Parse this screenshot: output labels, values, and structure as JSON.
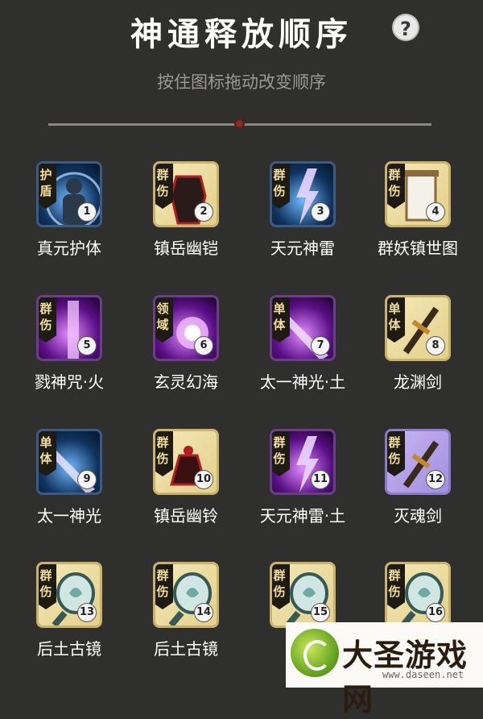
{
  "header": {
    "title": "神通释放顺序",
    "help": "?",
    "subtitle": "按住图标拖动改变顺序"
  },
  "skills": [
    {
      "order": "1",
      "name": "真元护体",
      "tag": "护盾",
      "theme": "blue",
      "icon": "shield-figure-icon"
    },
    {
      "order": "2",
      "name": "镇岳幽铠",
      "tag": "群伤",
      "theme": "gold",
      "icon": "armor-icon"
    },
    {
      "order": "3",
      "name": "天元神雷",
      "tag": "群伤",
      "theme": "blue",
      "icon": "lightning-icon"
    },
    {
      "order": "4",
      "name": "群妖镇世图",
      "tag": "群伤",
      "theme": "gold",
      "icon": "scroll-icon"
    },
    {
      "order": "5",
      "name": "戮神咒·火",
      "tag": "群伤",
      "theme": "purple",
      "icon": "curse-beam-icon"
    },
    {
      "order": "6",
      "name": "玄灵幻海",
      "tag": "领域",
      "theme": "purple",
      "icon": "vortex-icon"
    },
    {
      "order": "7",
      "name": "太一神光·土",
      "tag": "单体",
      "theme": "purple",
      "icon": "light-beam-icon"
    },
    {
      "order": "8",
      "name": "龙渊剑",
      "tag": "单体",
      "theme": "gold",
      "icon": "sword-icon"
    },
    {
      "order": "9",
      "name": "太一神光",
      "tag": "单体",
      "theme": "blue",
      "icon": "light-beam-icon"
    },
    {
      "order": "10",
      "name": "镇岳幽铃",
      "tag": "群伤",
      "theme": "gold",
      "icon": "bell-icon"
    },
    {
      "order": "11",
      "name": "天元神雷·土",
      "tag": "群伤",
      "theme": "purple",
      "icon": "lightning-icon"
    },
    {
      "order": "12",
      "name": "灭魂剑",
      "tag": "群伤",
      "theme": "violet",
      "icon": "sword-icon"
    },
    {
      "order": "13",
      "name": "后土古镜",
      "tag": "群伤",
      "theme": "gold",
      "icon": "mirror-icon"
    },
    {
      "order": "14",
      "name": "后土古镜",
      "tag": "群伤",
      "theme": "gold",
      "icon": "mirror-icon"
    },
    {
      "order": "15",
      "name": "后",
      "tag": "群伤",
      "theme": "gold",
      "icon": "mirror-icon"
    },
    {
      "order": "16",
      "name": "",
      "tag": "群伤",
      "theme": "gold",
      "icon": "mirror-icon"
    }
  ],
  "watermark": {
    "text": "大圣游戏网",
    "url": "www.daseen.net"
  }
}
